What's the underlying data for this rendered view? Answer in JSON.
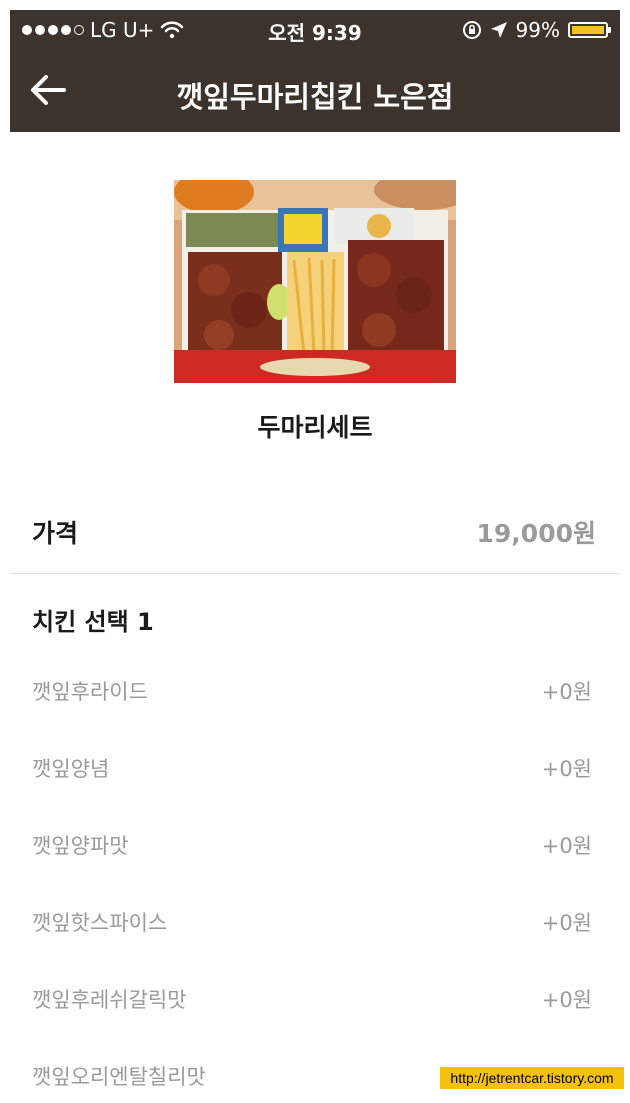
{
  "status_bar": {
    "carrier": "LG U+",
    "time": "오전 9:39",
    "battery": "99%",
    "battery_level": 0.99
  },
  "nav": {
    "title": "깻잎두마리칩킨 노은점",
    "back_icon": "arrow-left-icon"
  },
  "product": {
    "name": "두마리세트",
    "image_icon": "fried-chicken-box-photo"
  },
  "price": {
    "label": "가격",
    "value": "19,000원"
  },
  "section": {
    "title": "치킨 선택 1"
  },
  "options": [
    {
      "name": "깻잎후라이드",
      "extra": "+0원"
    },
    {
      "name": "깻잎양념",
      "extra": "+0원"
    },
    {
      "name": "깻잎양파맛",
      "extra": "+0원"
    },
    {
      "name": "깻잎핫스파이스",
      "extra": "+0원"
    },
    {
      "name": "깻잎후레쉬갈릭맛",
      "extra": "+0원"
    },
    {
      "name": "깻잎오리엔탈칠리맛",
      "extra": ""
    }
  ],
  "watermark": "http://jetrentcar.tistory.com",
  "colors": {
    "header_bg": "#3c332c",
    "muted_text": "#9a9a9a",
    "watermark_bg": "#f4c20d"
  }
}
